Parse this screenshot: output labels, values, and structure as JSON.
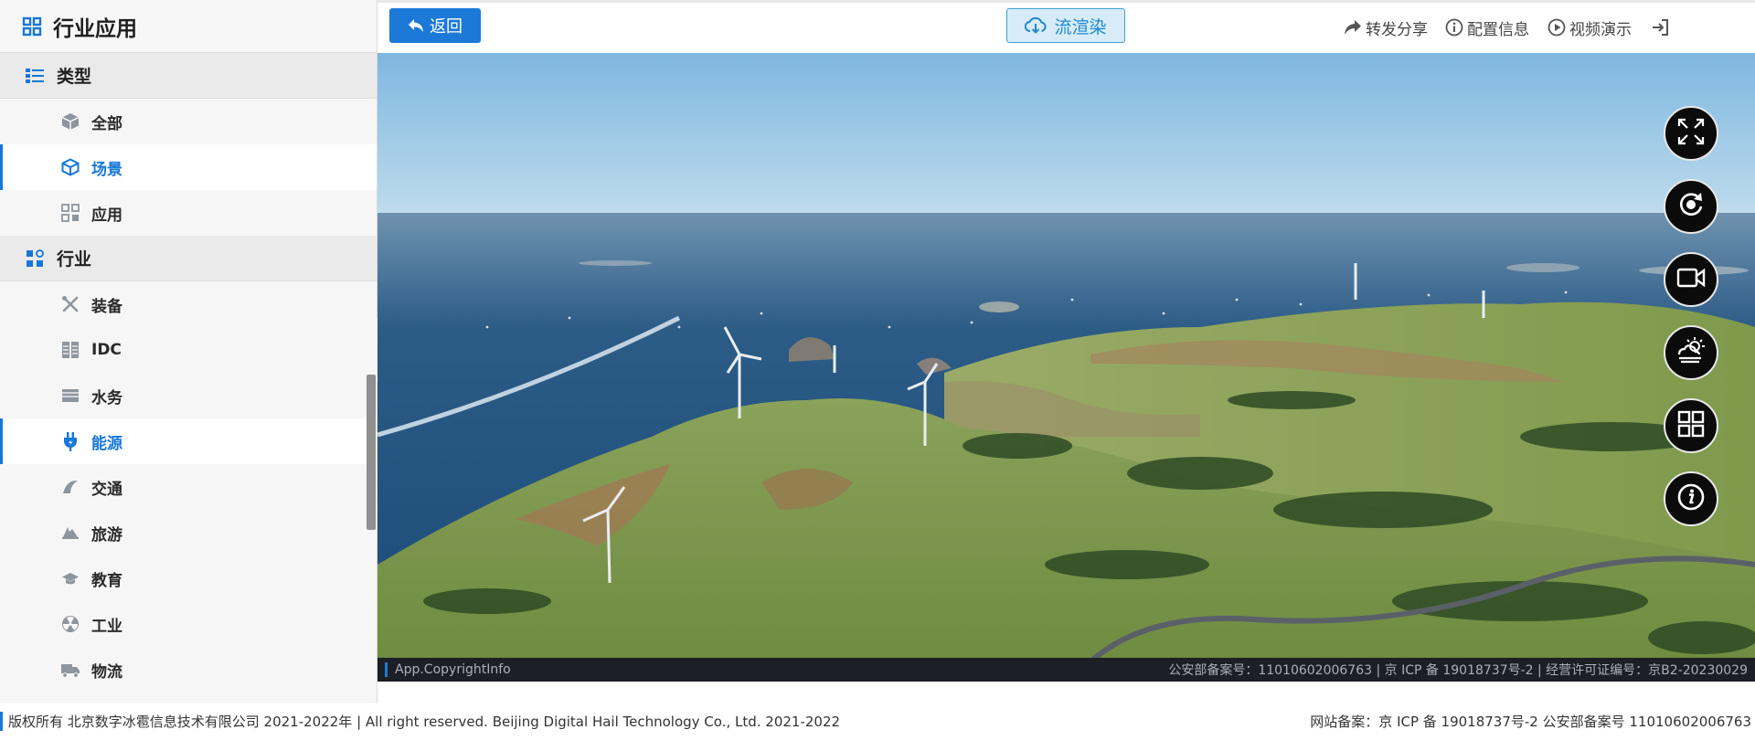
{
  "sidebar": {
    "title": "行业应用",
    "groups": [
      {
        "label": "类型",
        "items": [
          {
            "label": "全部",
            "icon": "cube-outline-icon"
          },
          {
            "label": "场景",
            "icon": "cube-icon",
            "active": true
          },
          {
            "label": "应用",
            "icon": "grid-icon"
          }
        ]
      },
      {
        "label": "行业",
        "items": [
          {
            "label": "装备",
            "icon": "tools-icon"
          },
          {
            "label": "IDC",
            "icon": "server-icon"
          },
          {
            "label": "水务",
            "icon": "water-icon"
          },
          {
            "label": "能源",
            "icon": "plug-icon",
            "active": true
          },
          {
            "label": "交通",
            "icon": "traffic-icon"
          },
          {
            "label": "旅游",
            "icon": "travel-icon"
          },
          {
            "label": "教育",
            "icon": "graduation-cap-icon"
          },
          {
            "label": "工业",
            "icon": "radiation-icon"
          },
          {
            "label": "物流",
            "icon": "truck-icon"
          }
        ]
      }
    ]
  },
  "topbar": {
    "back_label": "返回",
    "stream_label": "流渲染",
    "share_label": "转发分享",
    "config_label": "配置信息",
    "video_label": "视频演示"
  },
  "viewport": {
    "copyright_left": "App.CopyrightInfo",
    "copyright_right": "公安部备案号：11010602006763 | 京 ICP 备 19018737号-2 | 经营许可证编号：京B2-20230029",
    "controls": [
      "fullscreen-icon",
      "rotate-icon",
      "video-camera-icon",
      "weather-icon",
      "layout-grid-icon",
      "info-icon"
    ]
  },
  "footer": {
    "left": "版权所有 北京数字冰雹信息技术有限公司 2021-2022年 | All right reserved. Beijing Digital Hail Technology Co., Ltd. 2021-2022",
    "right": "网站备案：京 ICP 备 19018737号-2 公安部备案号 11010602006763"
  },
  "colors": {
    "accent": "#1c79d8",
    "active_text": "#1677d9",
    "sidebar_bg": "#f6f6f6"
  }
}
